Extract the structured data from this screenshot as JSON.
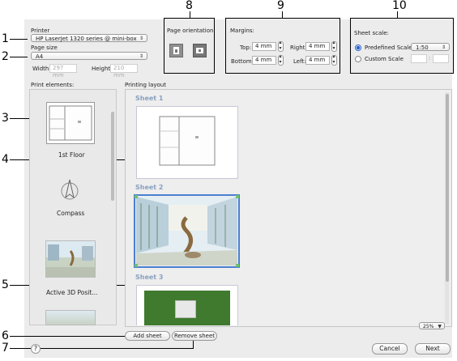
{
  "callouts": [
    "1",
    "2",
    "3",
    "4",
    "5",
    "6",
    "7",
    "8",
    "9",
    "10"
  ],
  "printer": {
    "label": "Printer",
    "value": "HP LaserJet 1320 series @ mini-box"
  },
  "page_size": {
    "label": "Page size",
    "value": "A4",
    "width_label": "Width",
    "width_value": "297 mm",
    "height_label": "Height",
    "height_value": "210 mm"
  },
  "orientation": {
    "label": "Page orientation:"
  },
  "margins": {
    "label": "Margins:",
    "top_label": "Top:",
    "top_value": "4 mm",
    "bottom_label": "Bottom:",
    "bottom_value": "4 mm",
    "right_label": "Right:",
    "right_value": "4 mm",
    "left_label": "Left:",
    "left_value": "4 mm"
  },
  "sheet_scale": {
    "label": "Sheet scale:",
    "predefined_label": "Predefined Scale",
    "predefined_value": "1:50",
    "custom_label": "Custom Scale",
    "custom_sep": ":"
  },
  "print_elements": {
    "label": "Print elements:",
    "items": [
      "1st Floor",
      "Compass",
      "Active 3D Posit..."
    ]
  },
  "printing_layout": {
    "label": "Printing layout",
    "sheets": [
      "Sheet 1",
      "Sheet 2",
      "Sheet 3"
    ],
    "zoom": "25%"
  },
  "buttons": {
    "add_sheet": "Add sheet",
    "remove_sheet": "Remove sheet",
    "cancel": "Cancel",
    "next": "Next",
    "help": "?"
  },
  "colors": {
    "accent": "#4a7fd1",
    "grass": "#3f7a2e",
    "dialog_bg": "#ececec"
  }
}
